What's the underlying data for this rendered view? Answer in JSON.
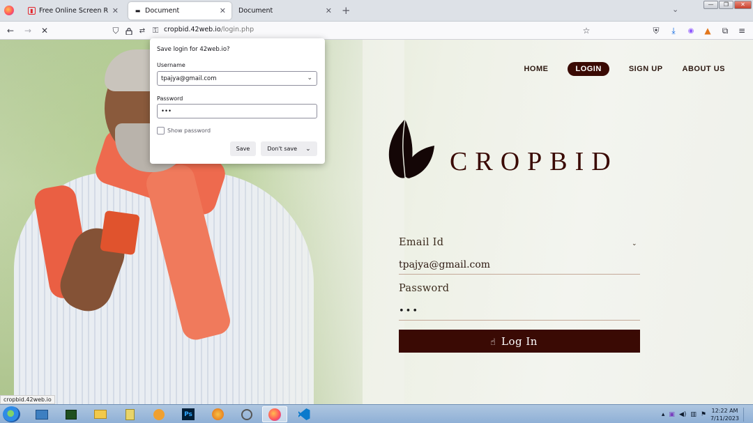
{
  "browser": {
    "tabs": [
      {
        "title": "Free Online Screen Recorder &",
        "icon": "screen-recorder-icon",
        "active": false
      },
      {
        "title": "Document",
        "icon": "dash-icon",
        "active": true
      },
      {
        "title": "Document",
        "icon": "none",
        "active": false
      }
    ],
    "close_glyph": "✕",
    "new_tab_glyph": "+",
    "tab_list_glyph": "⌄",
    "window_buttons": {
      "minimize": "—",
      "restore": "❐",
      "close": "✕"
    },
    "url_domain": "cropbid.42web.io",
    "url_path": "/login.php",
    "status_link": "cropbid.42web.io"
  },
  "save_login_popup": {
    "title": "Save login for 42web.io?",
    "username_label": "Username",
    "username_value": "tpajya@gmail.com",
    "password_label": "Password",
    "password_value": "•••",
    "show_password_label": "Show password",
    "save_label": "Save",
    "dont_save_label": "Don't save"
  },
  "site": {
    "nav": [
      {
        "label": "HOME",
        "active": false
      },
      {
        "label": "LOGIN",
        "active": true
      },
      {
        "label": "SIGN UP",
        "active": false
      },
      {
        "label": "ABOUT US",
        "active": false
      }
    ],
    "brand": "CROPBID",
    "email_label": "Email Id",
    "email_value": "tpajya@gmail.com",
    "password_label": "Password",
    "password_value": "•••",
    "login_button": "Log In",
    "colors": {
      "brand": "#3a0a04",
      "accent_underline": "#c4a898"
    }
  },
  "taskbar": {
    "apps": [
      "explorer-icon",
      "terminal-icon",
      "folder-icon",
      "notes-icon",
      "media-player-icon",
      "photoshop-icon",
      "fl-studio-icon",
      "snipping-icon",
      "firefox-icon",
      "vscode-icon"
    ],
    "active_app": "firefox-icon",
    "photoshop_label": "Ps",
    "time": "12:22 AM",
    "date": "7/11/2023"
  }
}
